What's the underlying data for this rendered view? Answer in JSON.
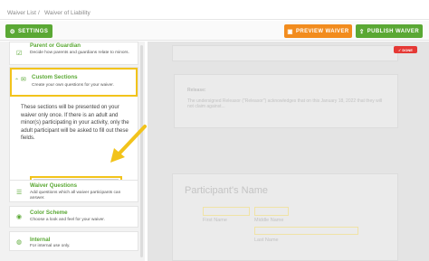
{
  "breadcrumb": {
    "root": "Waiver List",
    "separator": "/",
    "current": "Waiver of Liability"
  },
  "toolbar": {
    "settings_label": "SETTINGS",
    "preview_label": "PREVIEW WAIVER",
    "publish_label": "PUBLISH WAIVER"
  },
  "sidebar": {
    "parent_guardian": {
      "title": "Parent or Guardian",
      "desc": "Decide how parents and guardians relate to minors."
    },
    "custom_sections": {
      "title": "Custom Sections",
      "desc": "Create your own questions for your waiver.",
      "body": "These sections will be presented on your waiver only once. If there is an adult and minor(s) participating in your activity, only the adult participant will be asked to fill out these fields.",
      "add_button": "ADD NEW CUSTOM SECTION"
    },
    "waiver_questions": {
      "title": "Waiver Questions",
      "desc": "Add questions which all waiver participants can answer."
    },
    "color_scheme": {
      "title": "Color Scheme",
      "desc": "Choose a look and feel for your waiver."
    },
    "internal": {
      "title": "Internal",
      "desc": "For internal use only."
    }
  },
  "canvas": {
    "done_label": "DONE",
    "release_label": "Release:",
    "release_text": "The undersigned Releasor (\"Releasor\") acknowledges that on this January 18, 2022 that they will not claim against...",
    "participant_heading": "Participant's Name",
    "first_name_label": "First Name",
    "middle_name_label": "Middle Name",
    "last_name_label": "Last Name",
    "first_name_value": "",
    "middle_name_value": "",
    "last_name_value": ""
  },
  "colors": {
    "accent_green": "#5aa834",
    "accent_orange": "#f28c1e",
    "highlight": "#f2c31b"
  },
  "icons": [
    "settings-icon",
    "preview-icon",
    "publish-icon",
    "chevron-up-icon",
    "chevron-down-icon",
    "plus-icon",
    "arrow-annotation-icon"
  ]
}
